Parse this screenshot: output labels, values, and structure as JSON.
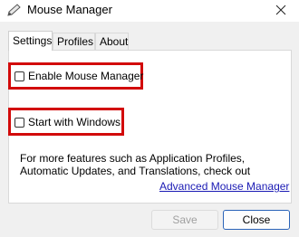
{
  "window": {
    "title": "Mouse Manager"
  },
  "tabs": [
    {
      "label": "Settings",
      "active": true
    },
    {
      "label": "Profiles",
      "active": false
    },
    {
      "label": "About",
      "active": false
    }
  ],
  "settings": {
    "enable_label": "Enable Mouse Manager",
    "enable_checked": false,
    "start_label": "Start with Windows",
    "start_checked": false,
    "info_line1": "For more features such as Application Profiles,",
    "info_line2": "Automatic Updates, and Translations, check out",
    "link_label": "Advanced Mouse Manager"
  },
  "buttons": {
    "save": "Save",
    "close": "Close"
  },
  "colors": {
    "highlight": "#d20a0a",
    "link": "#1a1ab4"
  },
  "icons": {
    "app": "pencil-icon",
    "close": "close-icon"
  }
}
